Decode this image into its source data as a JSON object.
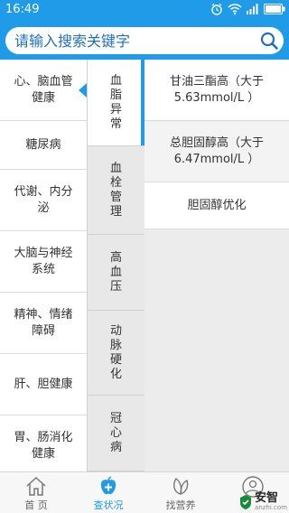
{
  "status_bar": {
    "time": "16:49"
  },
  "search": {
    "placeholder": "请输入搜索关键字"
  },
  "categories": [
    {
      "label": "心、脑血管健康",
      "selected": true
    },
    {
      "label": "糖尿病"
    },
    {
      "label": "代谢、内分泌"
    },
    {
      "label": "大脑与神经系统"
    },
    {
      "label": "精神、情绪障碍"
    },
    {
      "label": "肝、胆健康"
    },
    {
      "label": "胃、肠消化健康"
    }
  ],
  "subcategories": [
    {
      "label": "血脂异常",
      "selected": true
    },
    {
      "label": "血栓管理"
    },
    {
      "label": "高血压"
    },
    {
      "label": "动脉硬化"
    },
    {
      "label": "冠心病"
    }
  ],
  "items": [
    {
      "label": "甘油三酯高（大于5.63mmol/L ）"
    },
    {
      "label": "总胆固醇高（大于6.47mmol/L ）"
    },
    {
      "label": "胆固醇优化"
    }
  ],
  "bottom_nav": [
    {
      "label": "首 页",
      "icon": "home-icon"
    },
    {
      "label": "查状况",
      "icon": "apple-plus-icon",
      "active": true
    },
    {
      "label": "找营养",
      "icon": "leaf-icon"
    },
    {
      "label": "",
      "icon": "person-icon"
    }
  ],
  "watermark": {
    "text": "安智",
    "sub": "anzhi.com"
  },
  "colors": {
    "accent": "#1f9be8",
    "search_text": "#1f6fc0"
  }
}
